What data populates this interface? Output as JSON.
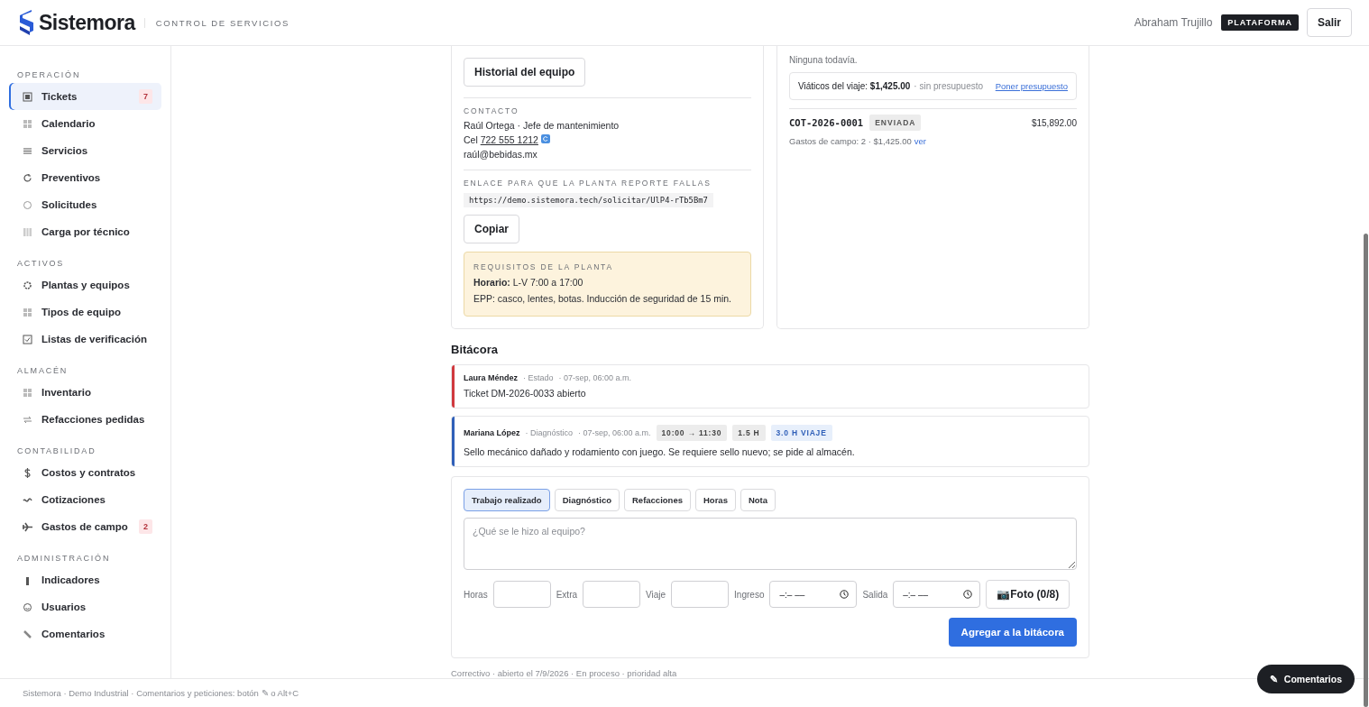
{
  "header": {
    "brand": "Sistemora",
    "subtitle": "CONTROL DE SERVICIOS",
    "user": "Abraham Trujillo",
    "role_badge": "PLATAFORMA",
    "logout": "Salir"
  },
  "sidebar": {
    "sections": [
      {
        "title": "OPERACIÓN",
        "items": [
          {
            "label": "Tickets",
            "selected": true,
            "badge": "7"
          },
          {
            "label": "Calendario",
            "selected": false
          },
          {
            "label": "Servicios",
            "selected": false
          },
          {
            "label": "Preventivos",
            "selected": false
          },
          {
            "label": "Solicitudes",
            "selected": false
          },
          {
            "label": "Carga por técnico",
            "selected": false
          }
        ]
      },
      {
        "title": "ACTIVOS",
        "items": [
          {
            "label": "Plantas y equipos",
            "selected": false
          },
          {
            "label": "Tipos de equipo",
            "selected": false
          },
          {
            "label": "Listas de verificación",
            "selected": false
          }
        ]
      },
      {
        "title": "ALMACÉN",
        "items": [
          {
            "label": "Inventario",
            "selected": false
          },
          {
            "label": "Refacciones pedidas",
            "selected": false
          }
        ]
      },
      {
        "title": "CONTABILIDAD",
        "items": [
          {
            "label": "Costos y contratos",
            "selected": false
          },
          {
            "label": "Cotizaciones",
            "selected": false
          },
          {
            "label": "Gastos de campo",
            "selected": false,
            "badge": "2"
          }
        ]
      },
      {
        "title": "ADMINISTRACIÓN",
        "items": [
          {
            "label": "Indicadores",
            "selected": false
          },
          {
            "label": "Usuarios",
            "selected": false
          },
          {
            "label": "Comentarios",
            "selected": false
          }
        ]
      }
    ]
  },
  "equipment_panel": {
    "history_button": "Historial del equipo",
    "contact": {
      "title": "CONTACTO",
      "name_line": "Raúl Ortega · Jefe de mantenimiento",
      "phone_label": "Cel",
      "phone": "722 555 1212",
      "email": "raúl@bebidas.mx"
    },
    "report_link": {
      "title": "ENLACE PARA QUE LA PLANTA REPORTE FALLAS",
      "url": "https://demo.sistemora.tech/solicitar/UlP4-rTb5Bm7",
      "copy_button": "Copiar"
    },
    "requirements": {
      "title": "REQUISITOS DE LA PLANTA",
      "schedule": "**Horario:** L-V 7:00 a 17:00",
      "ppe": "EPP: casco, lentes, botas. Inducción de seguridad de 15 min."
    }
  },
  "quotes_panel": {
    "empty": "Ninguna todavía.",
    "travel": {
      "text": "Viáticos del viaje: **$1,425.00**",
      "note": "· sin presupuesto",
      "link": "Poner presupuesto"
    },
    "quote": {
      "code": "COT-2026-0001",
      "status": "ENVIADA",
      "amount": "$15,892.00",
      "expenses": "Gastos de campo: 2 · $1,425.00",
      "link": "ver"
    }
  },
  "log": {
    "title": "Bitácora",
    "entries": [
      {
        "author": "Laura Méndez",
        "type": "· Estado",
        "date": "· 07-sep, 06:00 a.m.",
        "color": "#d0393e",
        "text": "Ticket DM-2026-0033 abierto"
      },
      {
        "author": "Mariana López",
        "type": "· Diagnóstico",
        "date": "· 07-sep, 06:00 a.m.",
        "color": "#2f5fb8",
        "text": "Sello mecánico dañado y rodamiento con juego. Se requiere sello nuevo; se pide al almacén.",
        "chips": [
          {
            "label": "10:00 → 11:30",
            "kind": "range"
          },
          {
            "label": "1.5 H",
            "kind": "hours"
          },
          {
            "label": "3.0 H VIAJE",
            "kind": "travel"
          }
        ]
      }
    ]
  },
  "form": {
    "tabs": [
      {
        "label": "Trabajo realizado",
        "selected": true
      },
      {
        "label": "Diagnóstico",
        "selected": false
      },
      {
        "label": "Refacciones",
        "selected": false
      },
      {
        "label": "Horas",
        "selected": false
      },
      {
        "label": "Nota",
        "selected": false
      }
    ],
    "placeholder": "¿Qué se le hizo al equipo?",
    "fields": [
      {
        "label": "Horas",
        "kind": "number"
      },
      {
        "label": "Extra",
        "kind": "number"
      },
      {
        "label": "Viaje",
        "kind": "number"
      },
      {
        "label": "Ingreso",
        "kind": "time",
        "placeholder": "–:– ––"
      },
      {
        "label": "Salida",
        "kind": "time",
        "placeholder": "–:– ––"
      }
    ],
    "photo_button": "📷Foto (0/8)",
    "submit": "Agregar a la bitácora"
  },
  "meta": "Correctivo · abierto el 7/9/2026 · En proceso · prioridad alta",
  "footer": "Sistemora · Demo Industrial · Comentarios y peticiones: botón ✎ o Alt+C",
  "floating_button": {
    "icon": "✎",
    "label": "Comentarios"
  }
}
